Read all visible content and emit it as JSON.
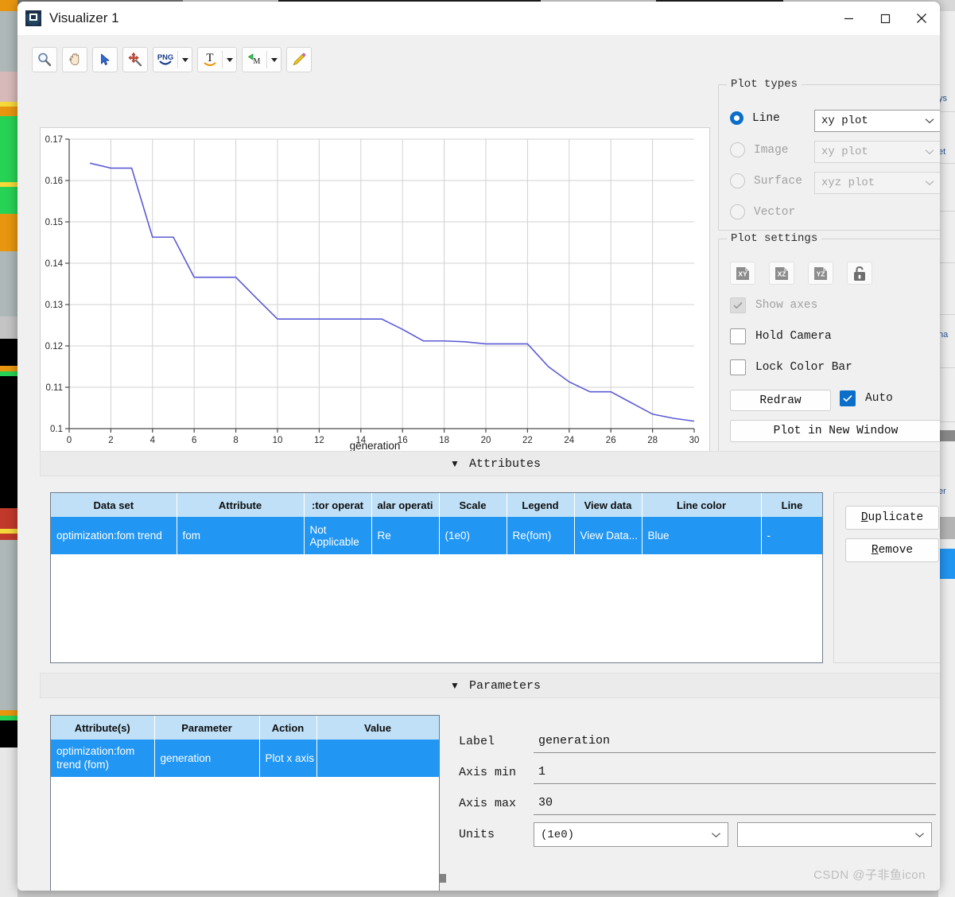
{
  "window": {
    "title": "Visualizer 1",
    "icon": "visualizer-app-icon",
    "minimize": "minimize-icon",
    "maximize": "maximize-icon",
    "close": "close-icon"
  },
  "toolbar": {
    "items": [
      {
        "name": "zoom-tool",
        "glyph": "magnifier"
      },
      {
        "name": "pan-tool",
        "glyph": "hand"
      },
      {
        "name": "select-tool",
        "glyph": "arrow"
      },
      {
        "name": "move-tool",
        "glyph": "move-wand"
      },
      {
        "name": "export-png-tool",
        "glyph": "png",
        "dropdown": true
      },
      {
        "name": "text-tool",
        "glyph": "text-t",
        "dropdown": true
      },
      {
        "name": "marker-tool",
        "glyph": "marker-m",
        "dropdown": true
      },
      {
        "name": "edit-tool",
        "glyph": "pencil"
      }
    ]
  },
  "plot_types": {
    "title": "Plot types",
    "options": [
      {
        "label": "Line",
        "selected": true,
        "enabled": true,
        "combo": "xy plot"
      },
      {
        "label": "Image",
        "selected": false,
        "enabled": false,
        "combo": "xy plot"
      },
      {
        "label": "Surface",
        "selected": false,
        "enabled": false,
        "combo": "xyz plot"
      },
      {
        "label": "Vector",
        "selected": false,
        "enabled": false,
        "combo": null
      }
    ]
  },
  "plot_settings": {
    "title": "Plot settings",
    "view_buttons": [
      "XY",
      "XZ",
      "YZ"
    ],
    "lock_button": "unlock-icon",
    "checkboxes": [
      {
        "label": "Show axes",
        "checked": true,
        "enabled": false
      },
      {
        "label": "Hold Camera",
        "checked": false,
        "enabled": true
      },
      {
        "label": "Lock Color Bar",
        "checked": false,
        "enabled": true
      }
    ],
    "redraw_label": "Redraw",
    "auto_label": "Auto",
    "auto_checked": true,
    "new_window_label": "Plot in New Window",
    "new_window_accel": "N"
  },
  "sections": {
    "attributes": "Attributes",
    "parameters": "Parameters",
    "triangle": "▼"
  },
  "attributes_table": {
    "columns": [
      "Data set",
      "Attribute",
      ":tor operat",
      "alar operati",
      "Scale",
      "Legend",
      "View data",
      "Line color",
      "Line"
    ],
    "rows": [
      {
        "data_set": "optimization:fom trend",
        "attribute": "fom",
        "vector_operation": "Not Applicable",
        "scalar_operation": "Re",
        "scale": "(1e0)",
        "legend": "Re(fom)",
        "view_data": "View Data...",
        "line_color": "Blue",
        "line_style": "-"
      }
    ],
    "buttons": [
      {
        "label": "Duplicate",
        "accel": "D"
      },
      {
        "label": "Remove",
        "accel": "R"
      }
    ]
  },
  "parameters_table": {
    "columns": [
      "Attribute(s)",
      "Parameter",
      "Action",
      "Value"
    ],
    "rows": [
      {
        "attributes": "optimization:fom trend (fom)",
        "parameter": "generation",
        "action": "Plot x axis",
        "value": ""
      }
    ]
  },
  "parameter_form": {
    "label_caption": "Label",
    "label_value": "generation",
    "axis_min_caption": "Axis min",
    "axis_min_value": "1",
    "axis_max_caption": "Axis max",
    "axis_max_value": "30",
    "units_caption": "Units",
    "units_value": "(1e0)",
    "units_value2": ""
  },
  "watermark": "CSDN @子非鱼icon",
  "colors": {
    "accent": "#0b6ec9",
    "row_select": "#2196f3",
    "header": "#bfe0f7",
    "line": "#5b5bd6"
  },
  "chart_data": {
    "type": "line",
    "title": "",
    "xlabel": "generation",
    "ylabel": "",
    "xlim": [
      0,
      30
    ],
    "ylim": [
      0.1,
      0.17
    ],
    "xticks": [
      0,
      2,
      4,
      6,
      8,
      10,
      12,
      14,
      16,
      18,
      20,
      22,
      24,
      26,
      28,
      30
    ],
    "yticks": [
      0.1,
      0.11,
      0.12,
      0.13,
      0.14,
      0.15,
      0.16,
      0.17
    ],
    "grid": true,
    "legend": "Re(fom)",
    "legend_position": "none",
    "line_color": "#5b5bd6",
    "series": [
      {
        "name": "Re(fom)",
        "x": [
          1,
          2,
          3,
          4,
          5,
          6,
          7,
          8,
          9,
          10,
          11,
          12,
          13,
          14,
          15,
          16,
          17,
          18,
          19,
          20,
          21,
          22,
          23,
          24,
          25,
          26,
          27,
          28,
          29,
          30
        ],
        "y": [
          0.1642,
          0.163,
          0.163,
          0.1463,
          0.1463,
          0.1366,
          0.1366,
          0.1366,
          0.1315,
          0.1265,
          0.1265,
          0.1265,
          0.1265,
          0.1265,
          0.1265,
          0.124,
          0.1212,
          0.1212,
          0.121,
          0.1205,
          0.1205,
          0.1205,
          0.115,
          0.1113,
          0.1089,
          0.1089,
          0.1062,
          0.1035,
          0.1025,
          0.1018
        ]
      }
    ]
  }
}
